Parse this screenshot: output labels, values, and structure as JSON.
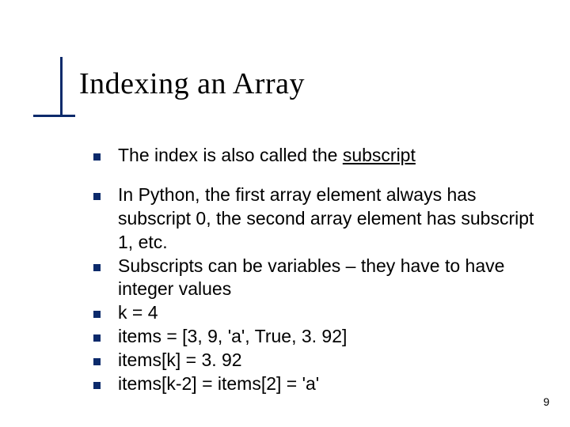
{
  "title": "Indexing an Array",
  "bullets": {
    "b0_pre": "The index is also called the ",
    "b0_underlined": "subscript",
    "b1": "In Python, the first array element always has subscript 0,  the second array element has subscript 1, etc.",
    "b2": "Subscripts can be variables – they have to have integer values",
    "b3": "k  = 4",
    "b4": "items = [3, 9, 'a', True, 3. 92]",
    "b5": "items[k] = 3. 92",
    "b6": "items[k-2] = items[2] = 'a'"
  },
  "page_number": "9"
}
